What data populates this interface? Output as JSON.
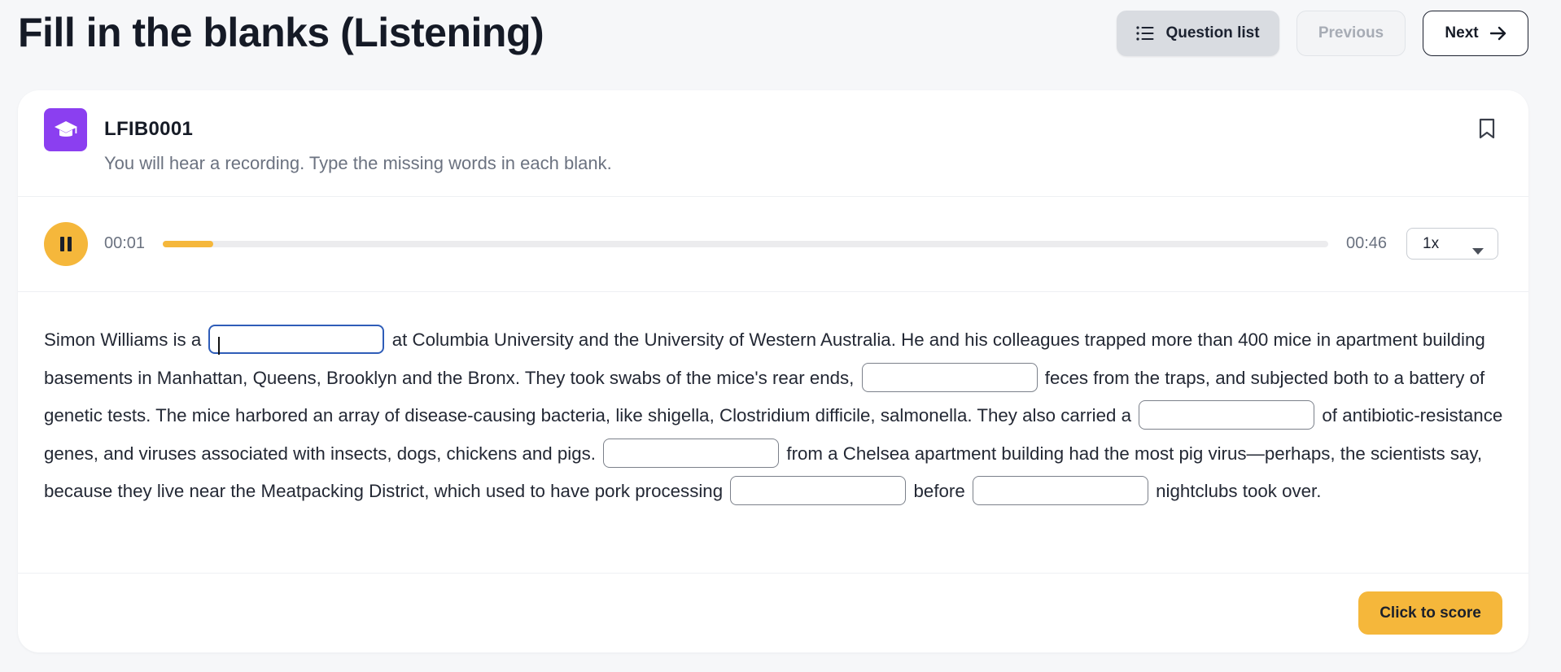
{
  "header": {
    "title": "Fill in the blanks (Listening)",
    "question_list_label": "Question list",
    "previous_label": "Previous",
    "next_label": "Next"
  },
  "question": {
    "id": "LFIB0001",
    "instruction": "You will hear a recording. Type the missing words in each blank.",
    "icon": "graduation-cap-icon"
  },
  "player": {
    "current_time": "00:01",
    "duration": "00:46",
    "progress_fraction": 0.043,
    "speed": "1x",
    "state_icon": "pause-icon"
  },
  "passage": {
    "segments": [
      "Simon Williams is a",
      "at Columbia University and the University of Western Australia. He and his colleagues trapped more than 400 mice in apartment building basements in Manhattan, Queens, Brooklyn and the Bronx. They took swabs of the mice's rear ends,",
      "feces from the traps, and subjected both to a battery of genetic tests. The mice harbored an array of disease-causing bacteria, like shigella, Clostridium difficile, salmonella. They also carried a",
      "of antibiotic-resistance genes, and viruses associated with insects, dogs, chickens and pigs.",
      "from a Chelsea apartment building had the most pig virus—perhaps, the scientists say, because they live near the Meatpacking District, which used to have pork processing",
      "before",
      "nightclubs took over."
    ],
    "blanks": [
      "",
      "",
      "",
      "",
      "",
      ""
    ]
  },
  "footer": {
    "score_label": "Click to score"
  },
  "colors": {
    "accent": "#f5b73b",
    "icon_bg": "#8b3ff0",
    "active_blank": "#2f5db8"
  }
}
